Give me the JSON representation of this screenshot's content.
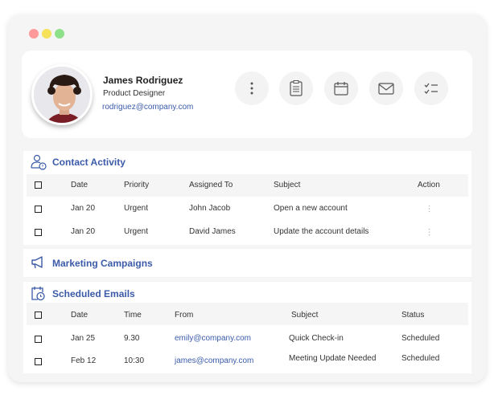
{
  "window": {
    "dots": [
      "#ff9a9a",
      "#f5e15a",
      "#8fe08a"
    ]
  },
  "profile": {
    "name": "James Rodriguez",
    "role": "Product Designer",
    "email": "rodriguez@company.com",
    "actions": [
      "more-icon",
      "clipboard-icon",
      "calendar-icon",
      "mail-icon",
      "checklist-icon"
    ]
  },
  "contact_activity": {
    "title": "Contact Activity",
    "headers": [
      "Date",
      "Priority",
      "Assigned To",
      "Subject",
      "Action"
    ],
    "rows": [
      {
        "date": "Jan 20",
        "priority": "Urgent",
        "assigned": "John Jacob",
        "subject": "Open a new account"
      },
      {
        "date": "Jan 20",
        "priority": "Urgent",
        "assigned": "David James",
        "subject": "Update the account details"
      }
    ]
  },
  "marketing": {
    "title": "Marketing Campaigns"
  },
  "scheduled_emails": {
    "title": "Scheduled Emails",
    "headers": [
      "Date",
      "Time",
      "From",
      "Subject",
      "Status"
    ],
    "rows": [
      {
        "date": "Jan 25",
        "time": "9.30",
        "from": "emily@company.com",
        "subject": "Quick Check-in",
        "status": "Scheduled"
      },
      {
        "date": "Feb 12",
        "time": "10:30",
        "from": "james@company.com",
        "subject": "Meeting Update Needed",
        "status": "Scheduled"
      }
    ]
  },
  "colors": {
    "accent": "#3b5ba9"
  }
}
